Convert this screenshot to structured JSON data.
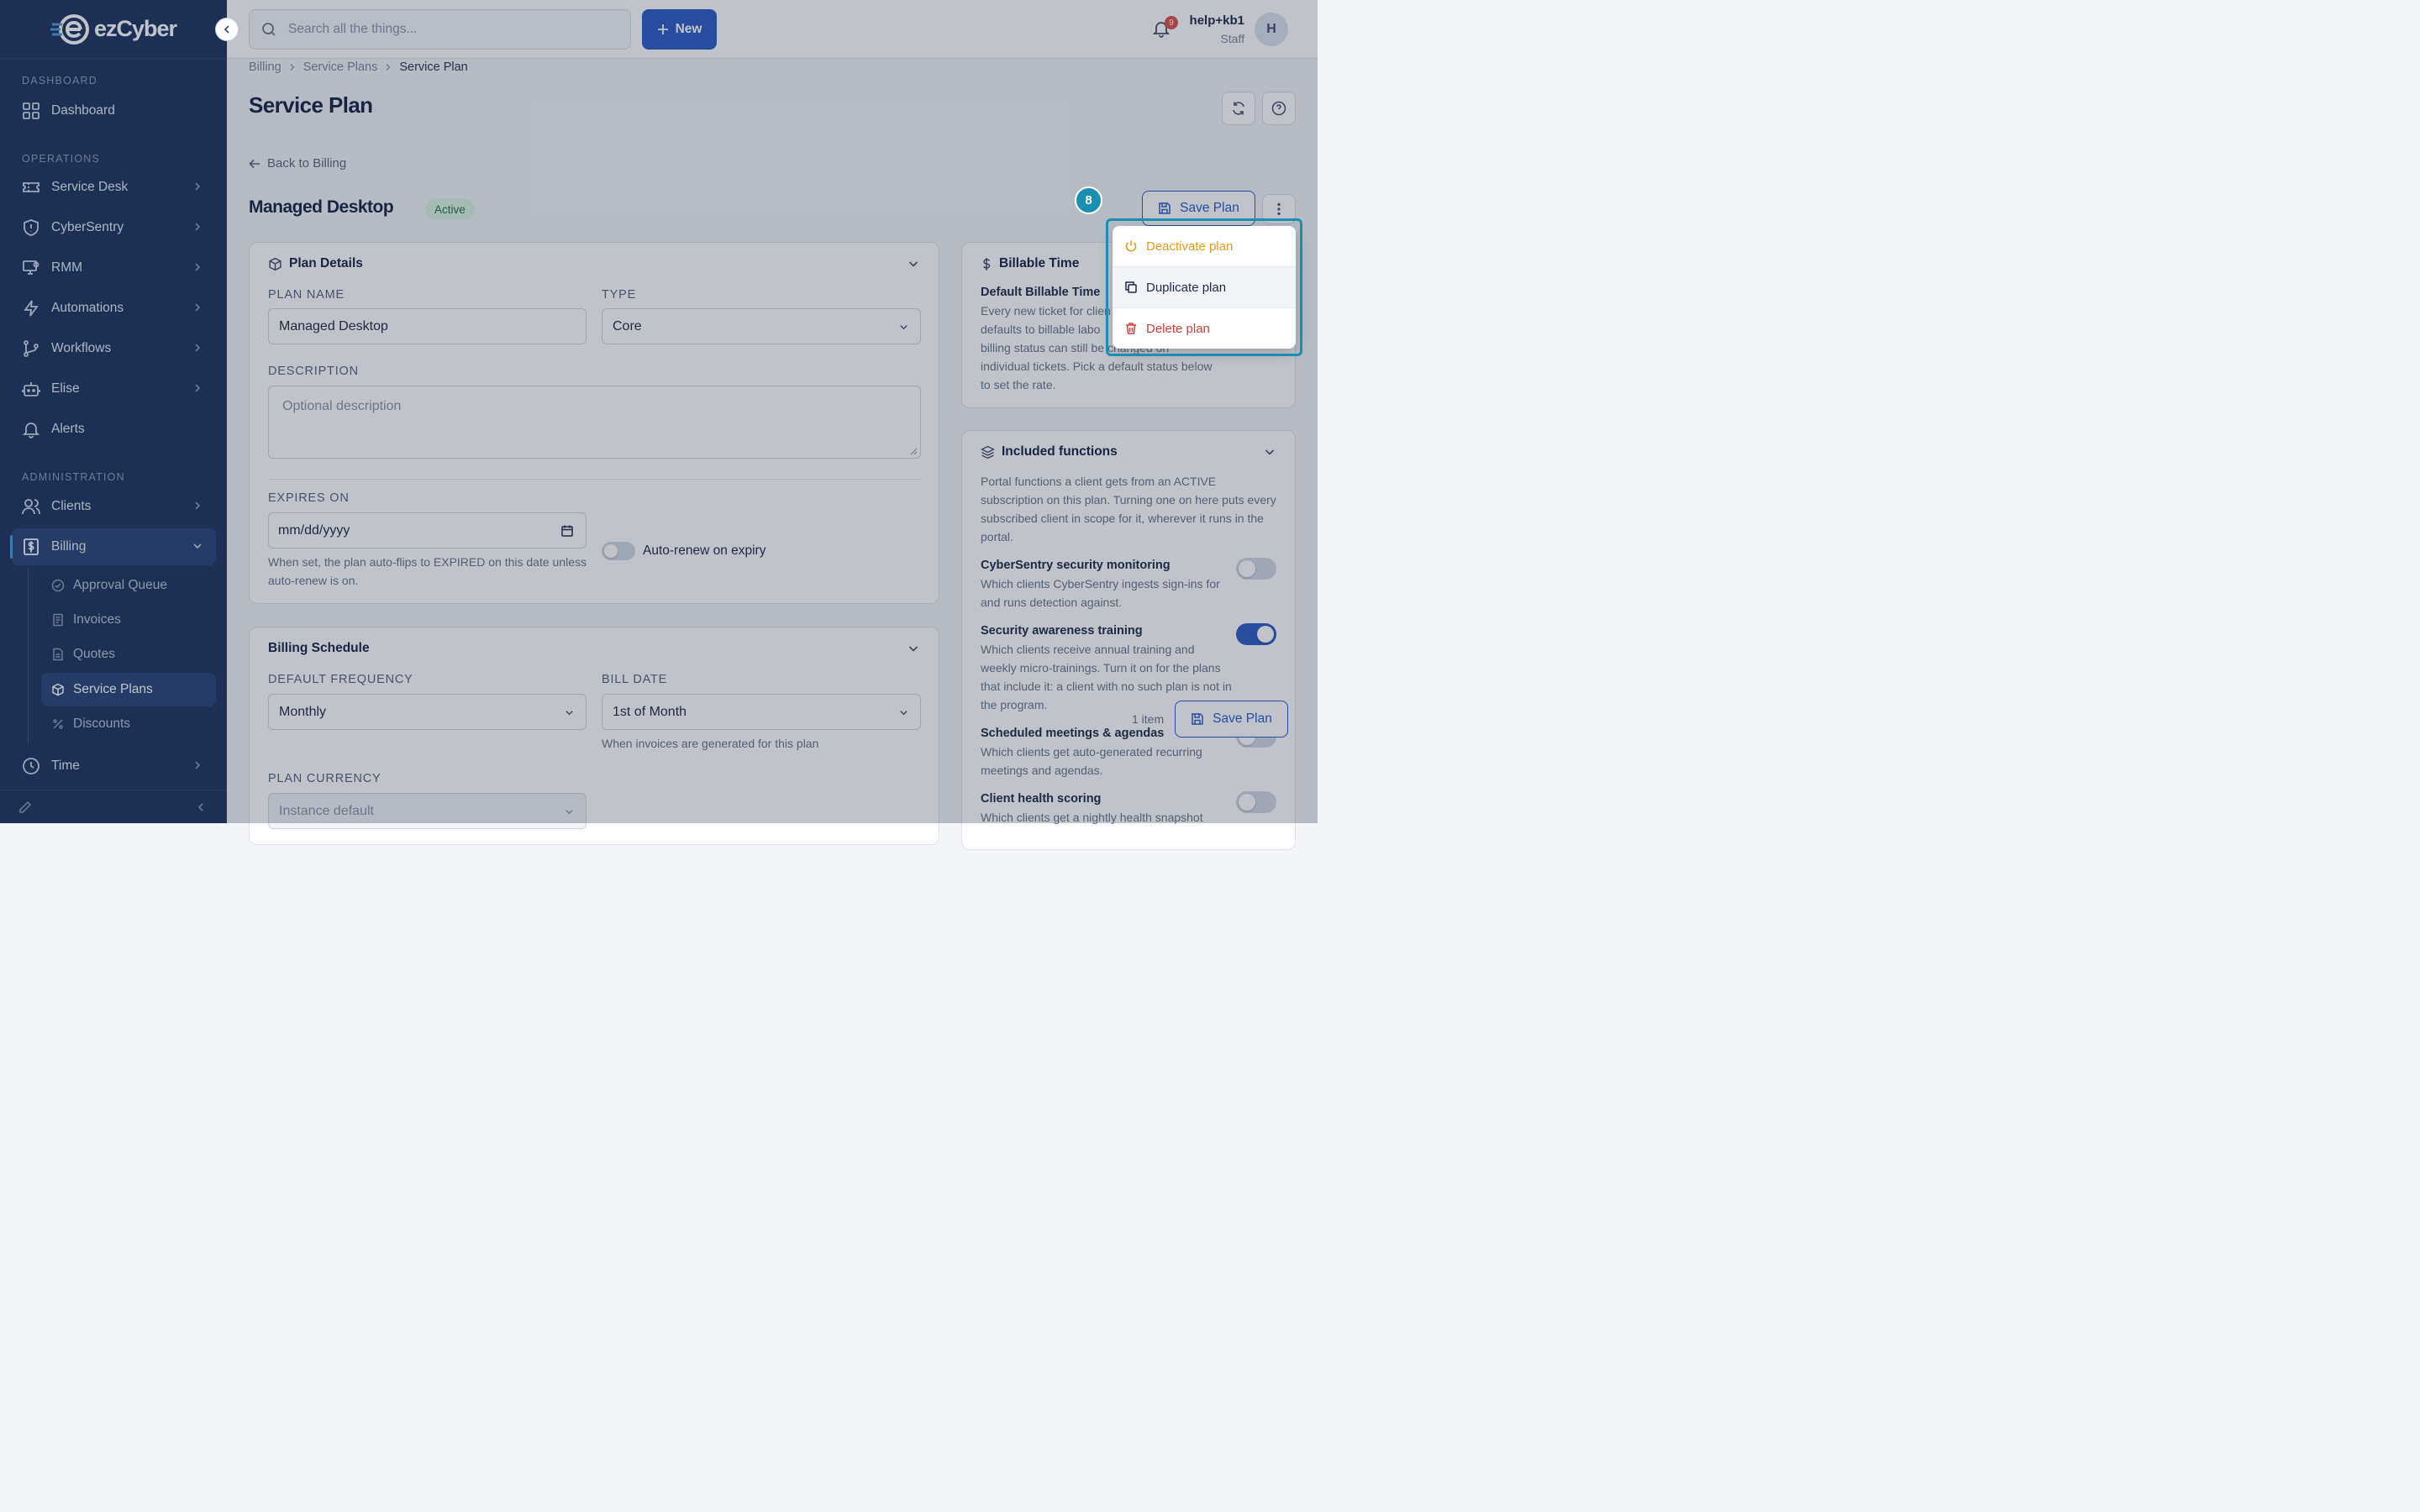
{
  "brand": {
    "logo_text": "ezCyber"
  },
  "sidebar": {
    "sections": {
      "dashboard": "DASHBOARD",
      "operations": "OPERATIONS",
      "administration": "ADMINISTRATION"
    },
    "items": [
      {
        "label": "Dashboard"
      },
      {
        "label": "Service Desk"
      },
      {
        "label": "CyberSentry"
      },
      {
        "label": "RMM"
      },
      {
        "label": "Automations"
      },
      {
        "label": "Workflows"
      },
      {
        "label": "Elise"
      },
      {
        "label": "Alerts"
      },
      {
        "label": "Clients"
      },
      {
        "label": "Billing"
      },
      {
        "label": "Time"
      }
    ],
    "billing_sub": [
      {
        "label": "Approval Queue"
      },
      {
        "label": "Invoices"
      },
      {
        "label": "Quotes"
      },
      {
        "label": "Service Plans"
      },
      {
        "label": "Discounts"
      }
    ]
  },
  "topbar": {
    "search_placeholder": "Search all the things...",
    "new_label": "New",
    "notification_count": "9",
    "user_name": "help+kb1",
    "user_role": "Staff",
    "avatar_initial": "H"
  },
  "breadcrumb": [
    "Billing",
    "Service Plans",
    "Service Plan"
  ],
  "page_title": "Service Plan",
  "back_label": "Back to Billing",
  "plan": {
    "name": "Managed Desktop",
    "status": "Active",
    "save_label": "Save Plan"
  },
  "plan_details": {
    "title": "Plan Details",
    "plan_name_label": "PLAN NAME",
    "plan_name_value": "Managed Desktop",
    "type_label": "TYPE",
    "type_value": "Core",
    "description_label": "DESCRIPTION",
    "description_placeholder": "Optional description",
    "expires_label": "EXPIRES ON",
    "expires_placeholder": "mm/dd/yyyy",
    "expires_help": "When set, the plan auto-flips to EXPIRED on this date unless auto-renew is on.",
    "auto_renew_label": "Auto-renew on expiry"
  },
  "billing_schedule": {
    "title": "Billing Schedule",
    "frequency_label": "DEFAULT FREQUENCY",
    "frequency_value": "Monthly",
    "bill_date_label": "BILL DATE",
    "bill_date_value": "1st of Month",
    "bill_date_help": "When invoices are generated for this plan",
    "currency_label": "PLAN CURRENCY",
    "currency_value": "Instance default"
  },
  "billable_time": {
    "title": "Billable Time",
    "subtitle": "Default Billable Time",
    "text_lines": [
      "Every new ticket for clien",
      "defaults to billable labo",
      "billing status can still be changed on",
      "individual tickets. Pick a default status below",
      "to set the rate."
    ]
  },
  "included_functions": {
    "title": "Included functions",
    "description": "Portal functions a client gets from an ACTIVE subscription on this plan. Turning one on here puts every subscribed client in scope for it, wherever it runs in the portal.",
    "items": [
      {
        "name": "CyberSentry security monitoring",
        "desc": "Which clients CyberSentry ingests sign-ins for and runs detection against."
      },
      {
        "name": "Security awareness training",
        "desc": "Which clients receive annual training and weekly micro-trainings. Turn it on for the plans that include it: a client with no such plan is not in the program."
      },
      {
        "name": "Scheduled meetings & agendas",
        "desc": "Which clients get auto-generated recurring meetings and agendas."
      },
      {
        "name": "Client health scoring",
        "desc": "Which clients get a nightly health snapshot"
      }
    ]
  },
  "dropdown_menu": {
    "items": [
      {
        "label": "Deactivate plan",
        "color": "#e29a1a"
      },
      {
        "label": "Duplicate plan",
        "color": "#1f2a44"
      },
      {
        "label": "Delete plan",
        "color": "#c9403a"
      }
    ]
  },
  "step_marker": "8",
  "floating_bar": {
    "count_label": "1 item",
    "save_label": "Save Plan"
  },
  "colors": {
    "sidebar_bg": "#1f3360",
    "accent": "#2d5cc4",
    "highlight": "#1a8fb0"
  }
}
